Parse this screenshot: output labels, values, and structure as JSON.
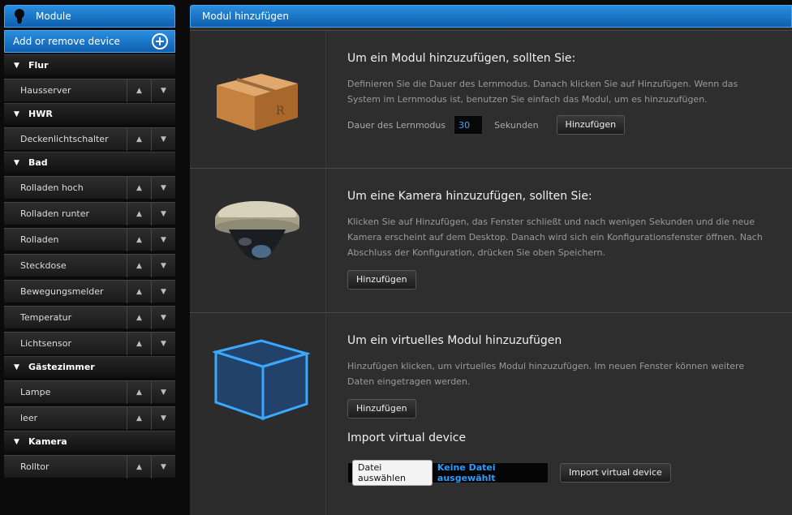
{
  "sidebar": {
    "header": "Module",
    "add_device": "Add or remove device",
    "groups": [
      {
        "name": "Flur",
        "items": [
          "Hausserver"
        ]
      },
      {
        "name": "HWR",
        "items": [
          "Deckenlichtschalter"
        ]
      },
      {
        "name": "Bad",
        "items": [
          "Rolladen hoch",
          "Rolladen runter",
          "Rolladen",
          "Steckdose",
          "Bewegungsmelder",
          "Temperatur",
          "Lichtsensor"
        ]
      },
      {
        "name": "Gästezimmer",
        "items": [
          "Lampe",
          "leer"
        ]
      },
      {
        "name": "Kamera",
        "items": [
          "Rolltor"
        ]
      }
    ]
  },
  "main": {
    "header": "Modul hinzufügen",
    "module": {
      "title": "Um ein Modul hinzuzufügen, sollten Sie:",
      "text": "Definieren Sie die Dauer des Lernmodus. Danach klicken Sie auf Hinzufügen. Wenn das System im Lernmodus ist, benutzen Sie einfach das Modul, um es hinzuzufügen.",
      "duration_label": "Dauer des Lernmodus",
      "duration_value": "30",
      "unit": "Sekunden",
      "button": "Hinzufügen"
    },
    "camera": {
      "title": "Um eine Kamera hinzuzufügen, sollten Sie:",
      "text": "Klicken Sie auf Hinzufügen, das Fenster schließt und nach wenigen Sekunden und die neue Kamera erscheint auf dem Desktop. Danach wird sich ein Konfigurationsfenster öffnen. Nach Abschluss der Konfiguration, drücken Sie oben Speichern.",
      "button": "Hinzufügen"
    },
    "virtual": {
      "title": "Um ein virtuelles Modul hinzuzufügen",
      "text": "Hinzufügen klicken, um virtuelles Modul hinzuzufügen. Im neuen Fenster können weitere Daten eingetragen werden.",
      "button": "Hinzufügen",
      "import_title": "Import virtual device",
      "file_button": "Datei auswählen",
      "file_status": "Keine Datei ausgewählt",
      "import_button": "Import virtual device"
    }
  }
}
